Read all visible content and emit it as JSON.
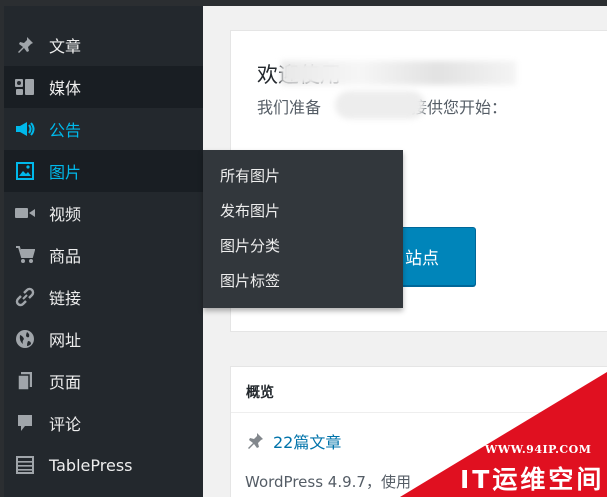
{
  "sidebar": {
    "items": [
      {
        "label": "文章",
        "icon": "pushpin-icon"
      },
      {
        "label": "媒体",
        "icon": "media-icon"
      },
      {
        "label": "公告",
        "icon": "megaphone-icon"
      },
      {
        "label": "图片",
        "icon": "image-icon"
      },
      {
        "label": "视频",
        "icon": "video-icon"
      },
      {
        "label": "商品",
        "icon": "cart-icon"
      },
      {
        "label": "链接",
        "icon": "link-icon"
      },
      {
        "label": "网址",
        "icon": "globe-icon"
      },
      {
        "label": "页面",
        "icon": "page-icon"
      },
      {
        "label": "评论",
        "icon": "comment-icon"
      },
      {
        "label": "TablePress",
        "icon": "table-icon"
      }
    ]
  },
  "flyout": {
    "items": [
      "所有图片",
      "发布图片",
      "图片分类",
      "图片标签"
    ]
  },
  "welcome": {
    "title_visible": "欢迎使用",
    "subtitle_start": "我们准备",
    "subtitle_end": "接供您开始：",
    "button_label": "站点"
  },
  "glance": {
    "title": "概览",
    "posts_label": "22篇文章",
    "version_text": "WordPress 4.9.7，使用"
  },
  "watermark": {
    "url": "WWW.94IP.COM",
    "brand": "IT运维空间"
  },
  "colors": {
    "sidebar_bg": "#23282d",
    "accent": "#00b9eb",
    "button": "#0085ba",
    "watermark": "#e01020"
  }
}
